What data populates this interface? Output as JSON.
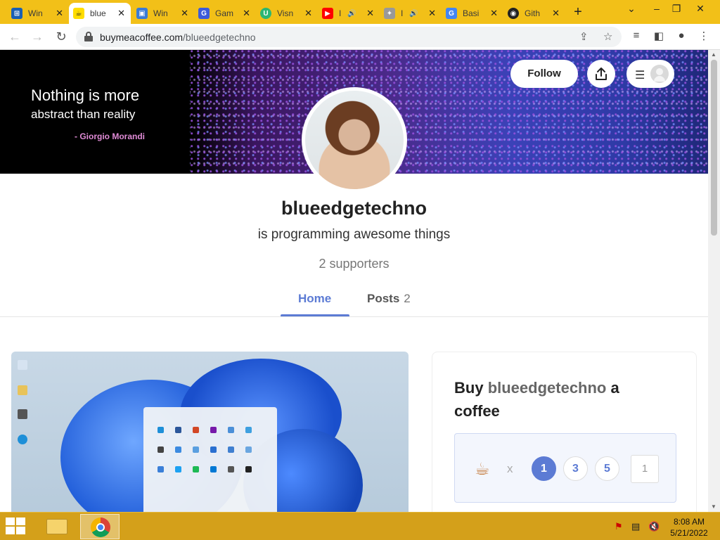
{
  "browser": {
    "tabs": [
      {
        "title": "Win",
        "icon": "windows-tab-icon",
        "color": "#1a5fb4"
      },
      {
        "title": "blue",
        "icon": "buymeacoffee-tab-icon",
        "color": "#ffdd00",
        "active": true
      },
      {
        "title": "Win",
        "icon": "windows-tab-icon",
        "color": "#3a7bd5"
      },
      {
        "title": "Gam",
        "icon": "gamer-tab-icon",
        "color": "#3b5bdb"
      },
      {
        "title": "Visn",
        "icon": "visn-tab-icon",
        "color": "#2bb673"
      },
      {
        "title": "I",
        "icon": "youtube-tab-icon",
        "color": "#ff0000",
        "audio": true
      },
      {
        "title": "I",
        "icon": "audio-tab-icon",
        "color": "#999999",
        "audio": true
      },
      {
        "title": "Basi",
        "icon": "basic-tab-icon",
        "color": "#4285f4"
      },
      {
        "title": "Gith",
        "icon": "github-tab-icon",
        "color": "#222222"
      }
    ],
    "new_tab": "+",
    "url_host": "buymeacoffee.com",
    "url_path": "/blueedgetechno"
  },
  "banner": {
    "quote_line1": "Nothing is more",
    "quote_line2": "abstract than reality",
    "quote_author": "- Giorgio Morandi",
    "follow_label": "Follow"
  },
  "profile": {
    "username": "blueedgetechno",
    "tagline": "is programming awesome things",
    "supporters": "2 supporters"
  },
  "tabs": {
    "home": "Home",
    "posts": "Posts",
    "posts_count": "2"
  },
  "support": {
    "title_prefix": "Buy ",
    "title_name": "blueedgetechno",
    "title_suffix": " a coffee",
    "times": "x",
    "options": [
      "1",
      "3",
      "5"
    ],
    "quantity": "1"
  },
  "taskbar": {
    "time": "8:08 AM",
    "date": "5/21/2022"
  },
  "colors": {
    "accent": "#5c7bd4",
    "chrome_frame": "#f2c018",
    "taskbar": "#d4a01a"
  }
}
